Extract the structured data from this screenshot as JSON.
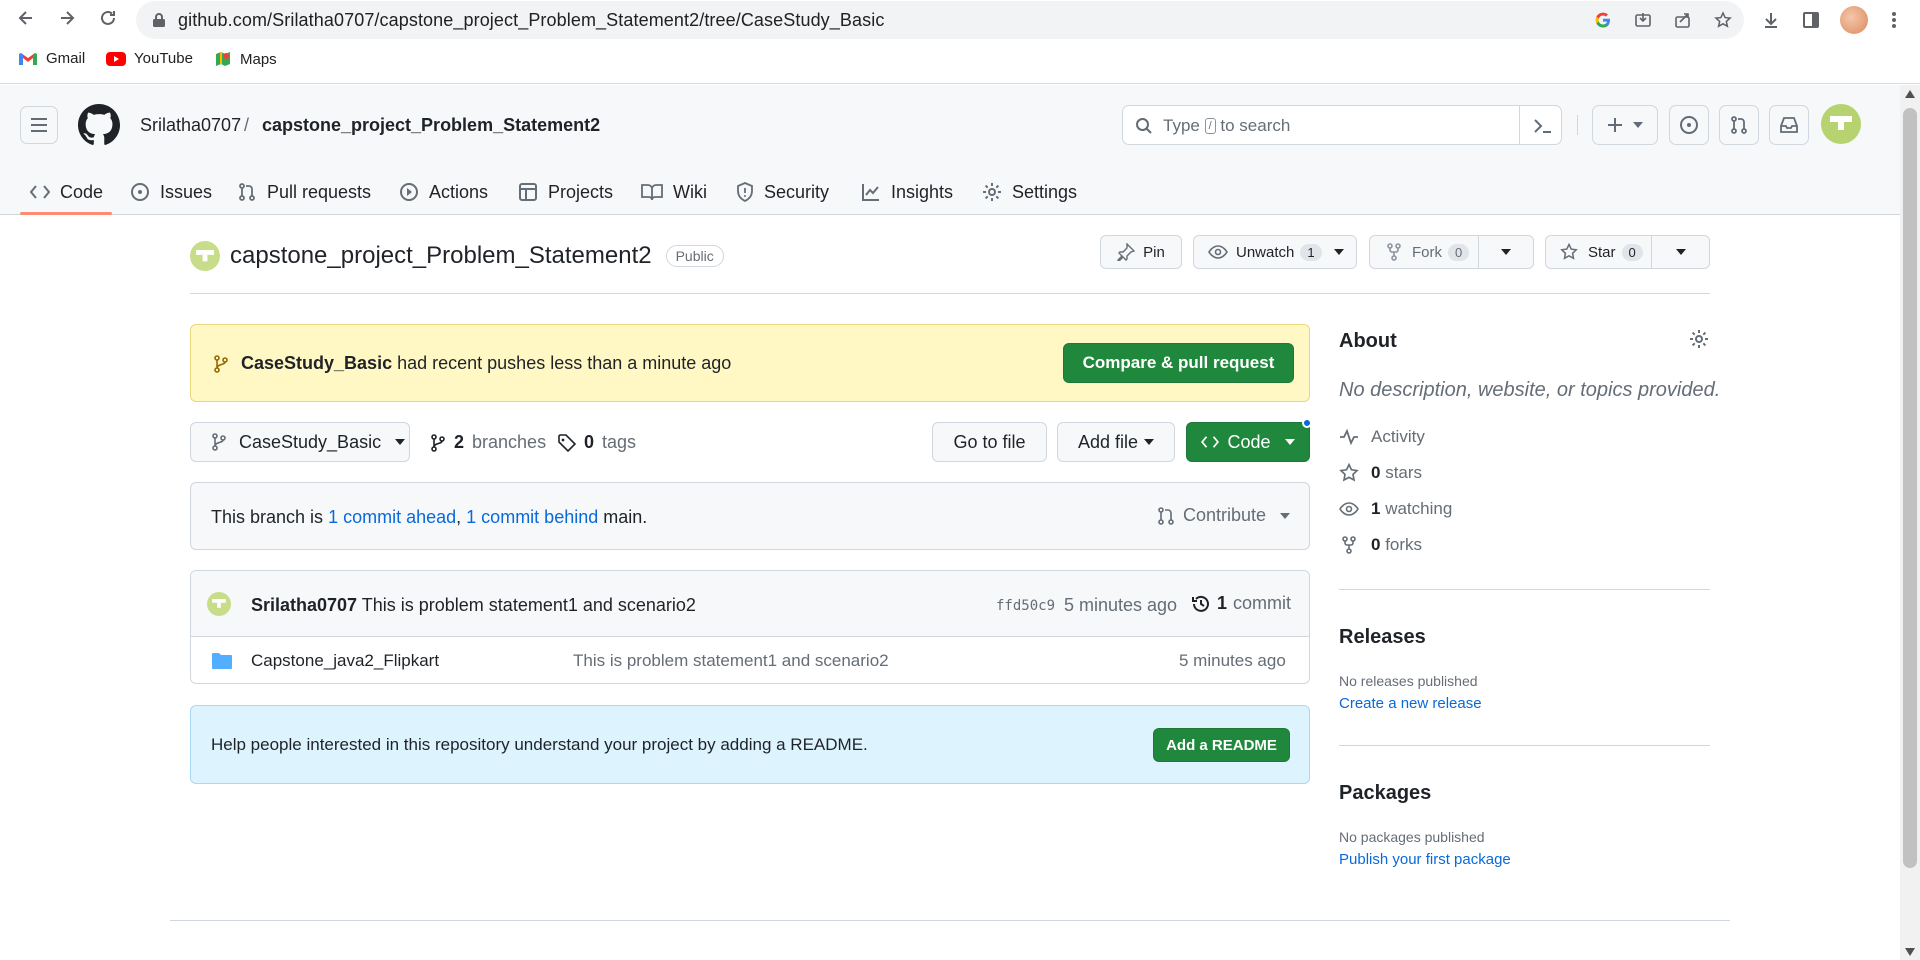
{
  "browser": {
    "url": "github.com/Srilatha0707/capstone_project_Problem_Statement2/tree/CaseStudy_Basic",
    "bookmarks": [
      {
        "label": "Gmail",
        "icon": "gmail-icon"
      },
      {
        "label": "YouTube",
        "icon": "youtube-icon"
      },
      {
        "label": "Maps",
        "icon": "maps-icon"
      }
    ]
  },
  "header": {
    "owner": "Srilatha0707",
    "separator": "/",
    "repo": "capstone_project_Problem_Statement2",
    "search_pre": "Type",
    "search_key": "/",
    "search_post": "to search"
  },
  "tabs": [
    {
      "label": "Code",
      "icon": "code-icon"
    },
    {
      "label": "Issues",
      "icon": "issues-icon"
    },
    {
      "label": "Pull requests",
      "icon": "pull-request-icon"
    },
    {
      "label": "Actions",
      "icon": "actions-icon"
    },
    {
      "label": "Projects",
      "icon": "projects-icon"
    },
    {
      "label": "Wiki",
      "icon": "wiki-icon"
    },
    {
      "label": "Security",
      "icon": "shield-icon"
    },
    {
      "label": "Insights",
      "icon": "graph-icon"
    },
    {
      "label": "Settings",
      "icon": "gear-icon"
    }
  ],
  "repo": {
    "name": "capstone_project_Problem_Statement2",
    "visibility": "Public",
    "pin": "Pin",
    "unwatch": "Unwatch",
    "watch_count": "1",
    "fork": "Fork",
    "fork_count": "0",
    "star": "Star",
    "star_count": "0"
  },
  "flash": {
    "branch": "CaseStudy_Basic",
    "message": "had recent pushes less than a minute ago",
    "button": "Compare & pull request"
  },
  "branchbar": {
    "branch": "CaseStudy_Basic",
    "branches_count": "2",
    "branches_label": "branches",
    "tags_count": "0",
    "tags_label": "tags",
    "go_to_file": "Go to file",
    "add_file": "Add file",
    "code": "Code"
  },
  "compare": {
    "prefix": "This branch is",
    "ahead": "1 commit ahead",
    "comma": ",",
    "behind": "1 commit behind",
    "suffix": "main.",
    "contribute": "Contribute"
  },
  "commit": {
    "author": "Srilatha0707",
    "message": "This is problem statement1 and scenario2",
    "sha": "ffd50c9",
    "time": "5 minutes ago",
    "count": "1",
    "count_label": "commit"
  },
  "files": [
    {
      "name": "Capstone_java2_Flipkart",
      "message": "This is problem statement1 and scenario2",
      "time": "5 minutes ago"
    }
  ],
  "readme_prompt": {
    "text": "Help people interested in this repository understand your project by adding a README.",
    "button": "Add a README"
  },
  "about": {
    "title": "About",
    "description": "No description, website, or topics provided.",
    "activity": "Activity",
    "stars_count": "0",
    "stars_label": "stars",
    "watching_count": "1",
    "watching_label": "watching",
    "forks_count": "0",
    "forks_label": "forks"
  },
  "releases": {
    "title": "Releases",
    "empty": "No releases published",
    "link": "Create a new release"
  },
  "packages": {
    "title": "Packages",
    "empty": "No packages published",
    "link": "Publish your first package"
  },
  "colors": {
    "primary_button": "#1f883d",
    "link": "#0969da",
    "flash_background": "#fff8c5",
    "readme_background": "#ddf4ff",
    "active_tab_underline": "#fd8c73"
  }
}
